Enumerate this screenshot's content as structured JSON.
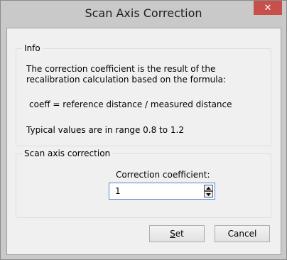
{
  "window": {
    "title": "Scan Axis Correction",
    "close_glyph": "✕"
  },
  "info": {
    "legend": "Info",
    "line1": "The correction coefficient is the result of the",
    "line2": "recalibration calculation based on the formula:",
    "formula": "coeff = reference distance / measured distance",
    "typical": "Typical values are in range 0.8 to 1.2"
  },
  "scan": {
    "legend": "Scan axis correction",
    "coeff_label": "Correction coefficient:",
    "coeff_value": "1"
  },
  "buttons": {
    "set": "Set",
    "set_mnemonic": "S",
    "set_rest": "et",
    "cancel": "Cancel"
  },
  "icons": {
    "close": "close-icon",
    "spin_up": "spin-up-icon",
    "spin_down": "spin-down-icon"
  }
}
